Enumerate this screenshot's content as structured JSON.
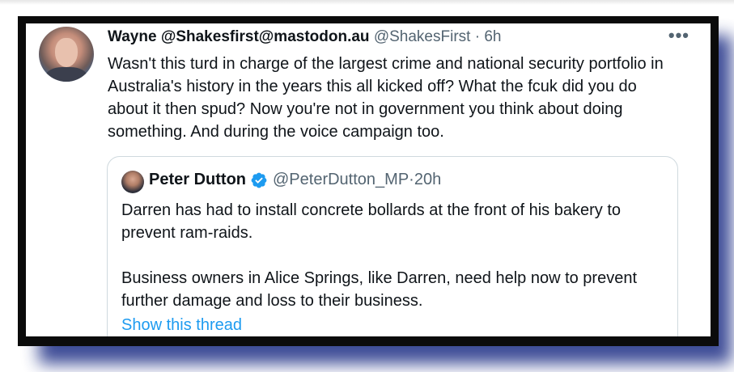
{
  "tweet": {
    "display_name": "Wayne @Shakesfirst@mastodon.au",
    "handle": "@ShakesFirst",
    "separator": "·",
    "time": "6h",
    "more_label": "•••",
    "text": "Wasn't this turd in charge of the largest crime and national security portfolio in Australia's history in the years this all kicked off? What the fcuk did you do about it then spud? Now you're not in government you think about doing something. And during the voice campaign too."
  },
  "quoted": {
    "display_name": "Peter Dutton",
    "verified_color": "#1d9bf0",
    "handle": "@PeterDutton_MP",
    "separator": "·",
    "time": "20h",
    "paragraphs": [
      "Darren has had to install concrete bollards at the front of his bakery to prevent ram-raids.",
      "Business owners in Alice Springs, like Darren, need help now to prevent further damage and loss to their business."
    ],
    "show_thread_label": "Show this thread"
  },
  "colors": {
    "frame": "#0b0b0b",
    "shadow": "#2a3a8c",
    "link": "#1d9bf0",
    "muted": "#536471"
  }
}
